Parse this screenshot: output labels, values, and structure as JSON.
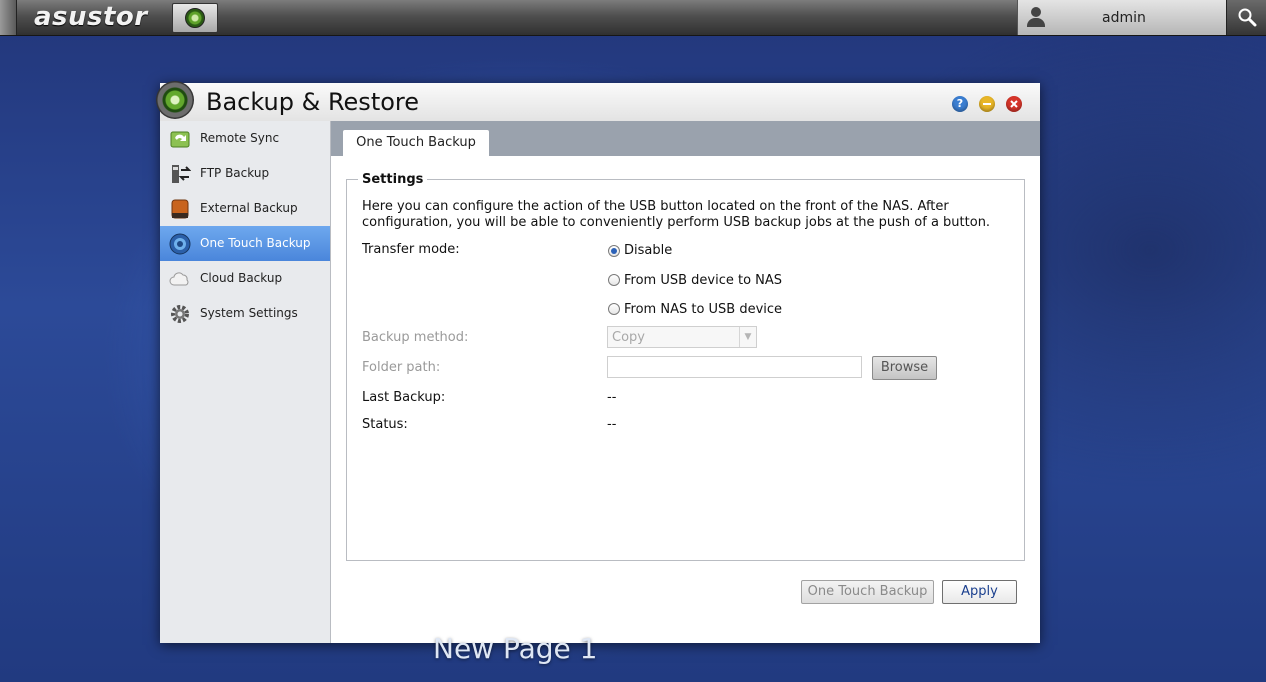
{
  "topbar": {
    "brand": "asustor",
    "username": "admin"
  },
  "window": {
    "title": "Backup & Restore",
    "controls": {
      "help": "?"
    }
  },
  "sidebar": {
    "items": [
      {
        "label": "Remote Sync",
        "icon": "remote-sync-icon",
        "active": false
      },
      {
        "label": "FTP Backup",
        "icon": "ftp-backup-icon",
        "active": false
      },
      {
        "label": "External Backup",
        "icon": "external-drive-icon",
        "active": false
      },
      {
        "label": "One Touch Backup",
        "icon": "one-touch-icon",
        "active": true
      },
      {
        "label": "Cloud Backup",
        "icon": "cloud-icon",
        "active": false
      },
      {
        "label": "System Settings",
        "icon": "gear-icon",
        "active": false
      }
    ]
  },
  "tabs": [
    {
      "label": "One Touch Backup",
      "active": true
    }
  ],
  "settings": {
    "legend": "Settings",
    "description": "Here you can configure the action of the USB button located on the front of the NAS. After configuration, you will be able to conveniently perform USB backup jobs at the push of a button.",
    "transfer_mode": {
      "label": "Transfer mode:",
      "options": [
        "Disable",
        "From USB device to NAS",
        "From NAS to USB device"
      ],
      "selected": "Disable"
    },
    "backup_method": {
      "label": "Backup method:",
      "value": "Copy"
    },
    "folder_path": {
      "label": "Folder path:",
      "value": "",
      "browse_label": "Browse"
    },
    "last_backup": {
      "label": "Last Backup:",
      "value": "--"
    },
    "status": {
      "label": "Status:",
      "value": "--"
    }
  },
  "footer": {
    "one_touch_label": "One Touch Backup",
    "apply_label": "Apply"
  },
  "desktop": {
    "label": "New Page 1"
  }
}
